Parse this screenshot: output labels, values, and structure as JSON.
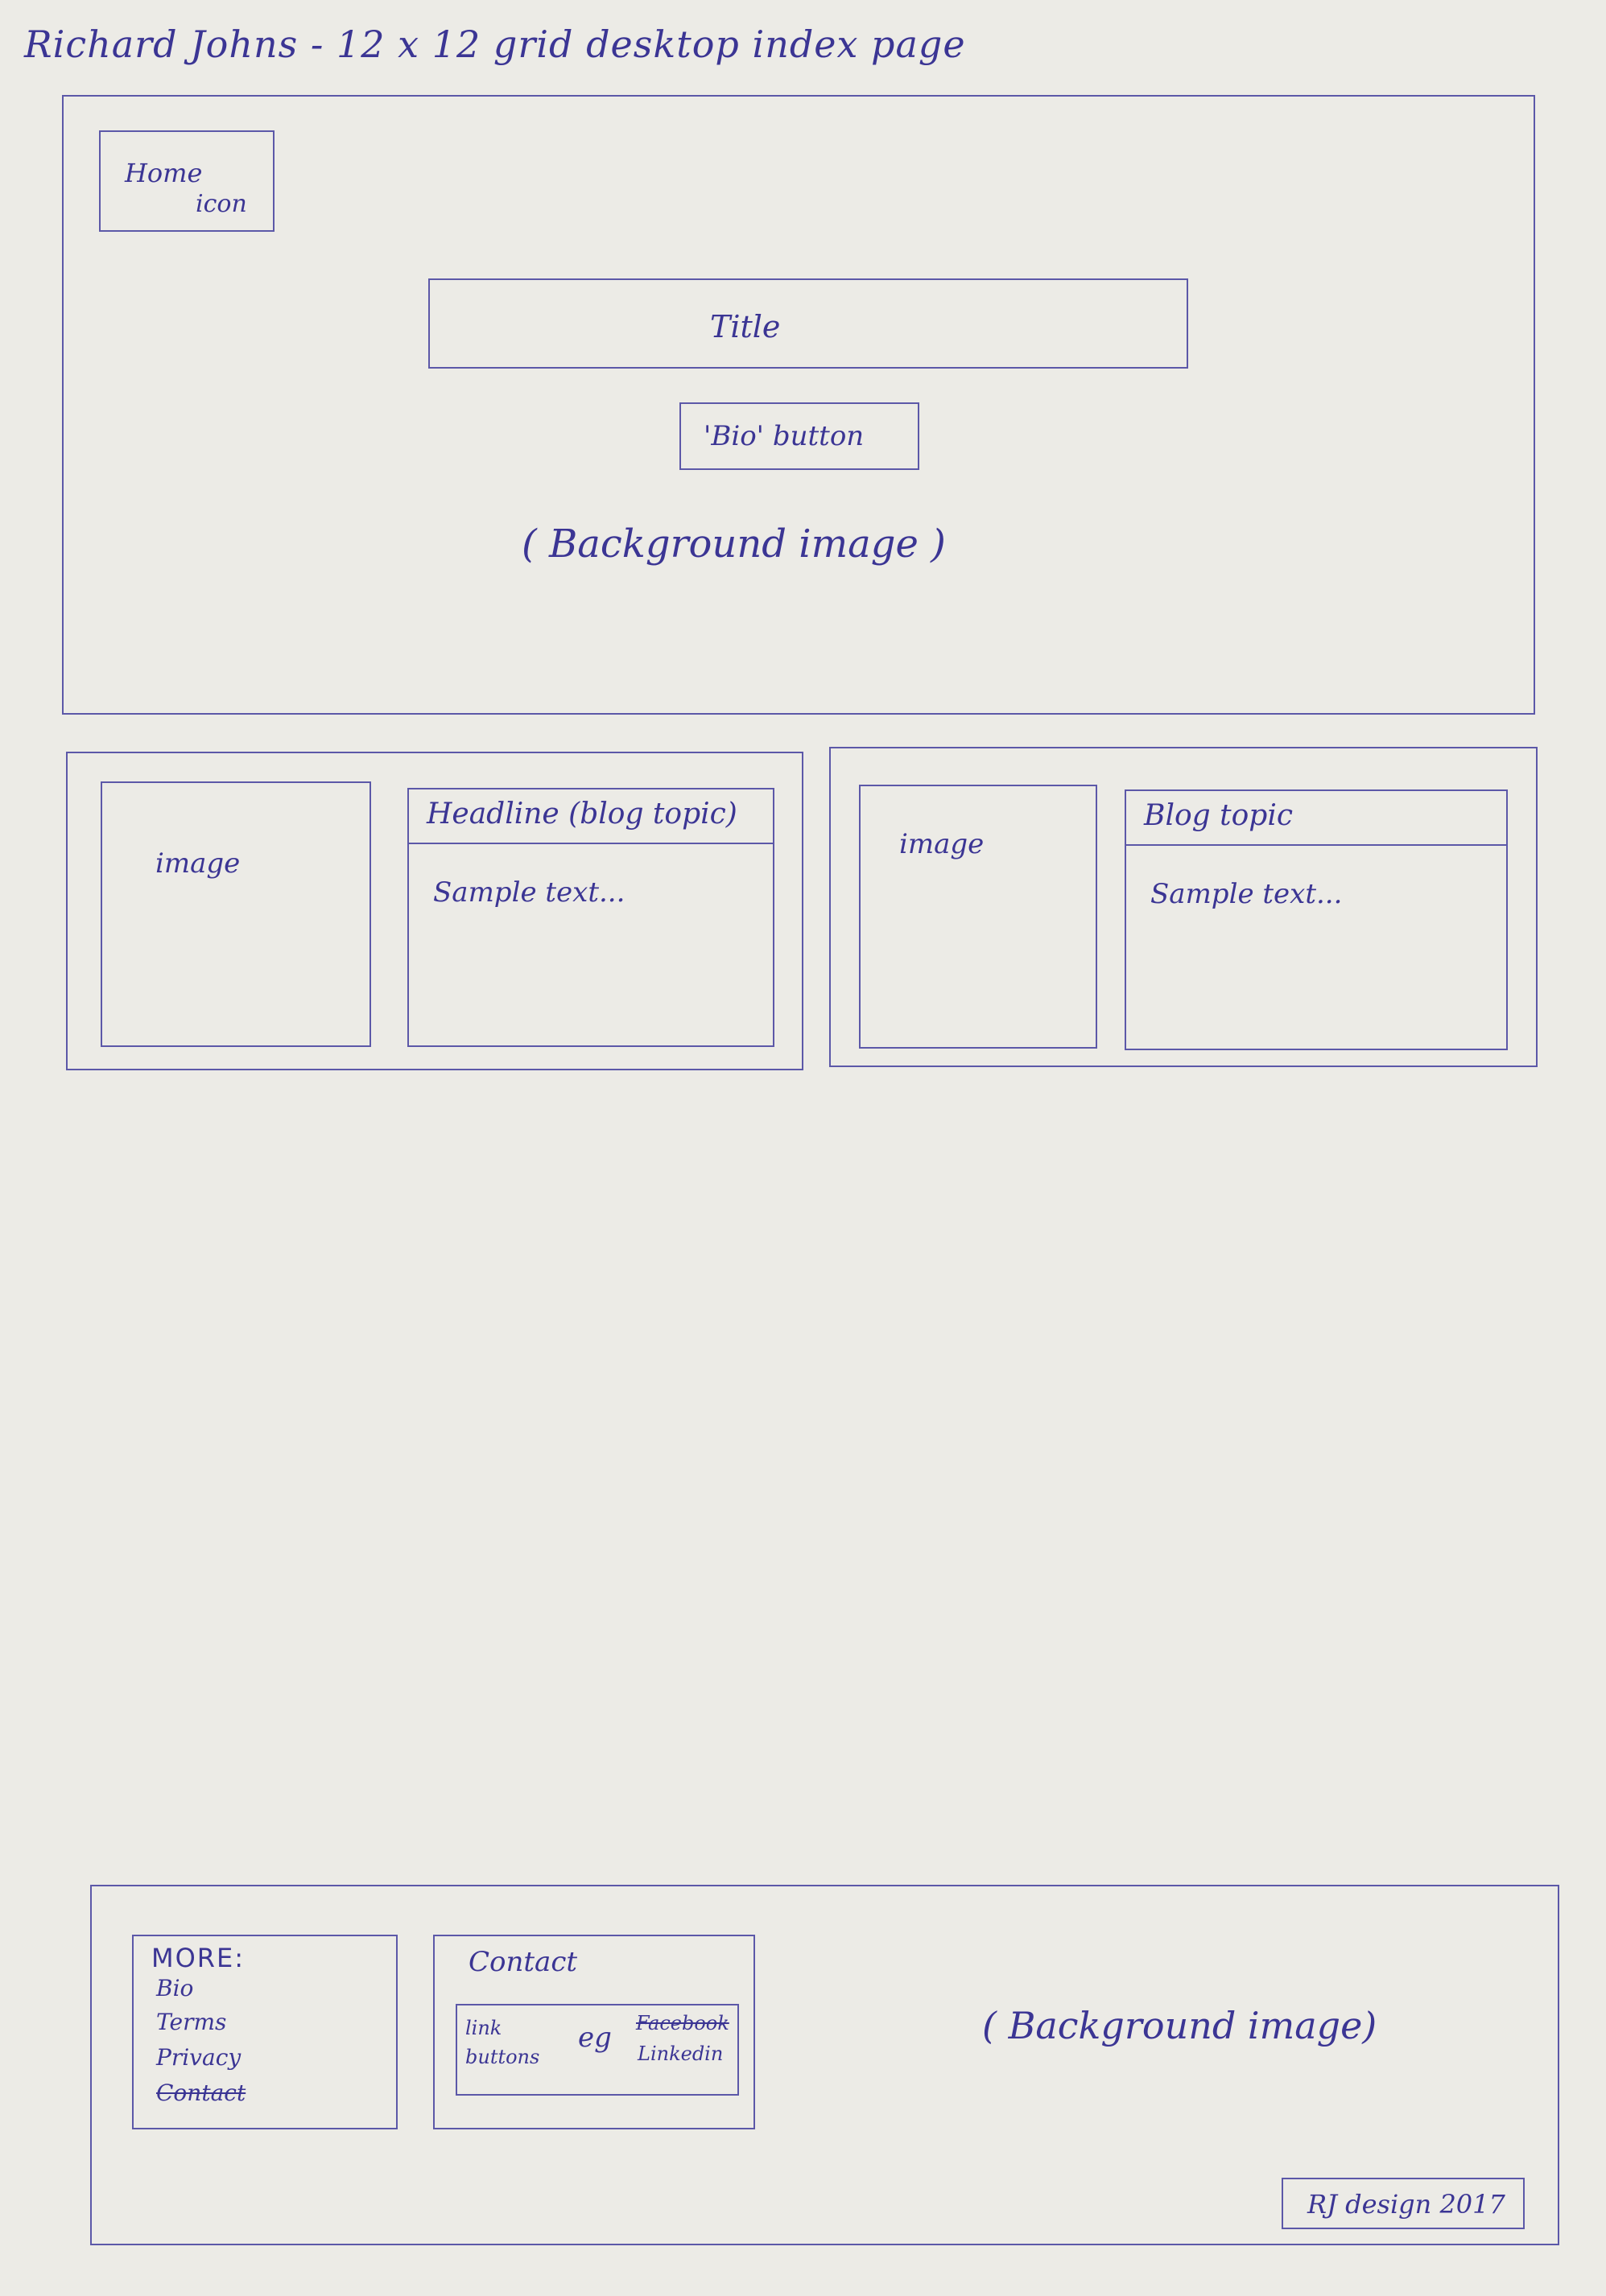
{
  "page_title": "Richard Johns - 12 x 12 grid desktop index page",
  "hero": {
    "home_icon_line1": "Home",
    "home_icon_line2": "icon",
    "title": "Title",
    "bio_button": "'Bio' button",
    "background_label": "( Background image )"
  },
  "blog": {
    "posts": [
      {
        "image_label": "image",
        "headline": "Headline (blog topic)",
        "sample_text": "Sample text..."
      },
      {
        "image_label": "image",
        "headline": "Blog topic",
        "sample_text": "Sample text..."
      }
    ]
  },
  "footer": {
    "more_title": "MORE:",
    "more_links": [
      "Bio",
      "Terms",
      "Privacy",
      "Contact"
    ],
    "contact_title": "Contact",
    "links_label_1": "link",
    "links_label_2": "buttons",
    "eg": "eg",
    "social_1": "Facebook",
    "social_2": "Linkedin",
    "background_label": "( Background image)",
    "credit": "RJ design 2017"
  }
}
